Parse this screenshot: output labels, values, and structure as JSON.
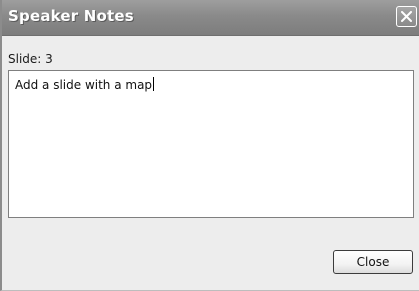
{
  "window": {
    "title": "Speaker Notes",
    "close_icon": "close-icon"
  },
  "slide": {
    "label": "Slide: 3"
  },
  "notes": {
    "text": "Add a slide with a map"
  },
  "buttons": {
    "close_label": "Close"
  }
}
